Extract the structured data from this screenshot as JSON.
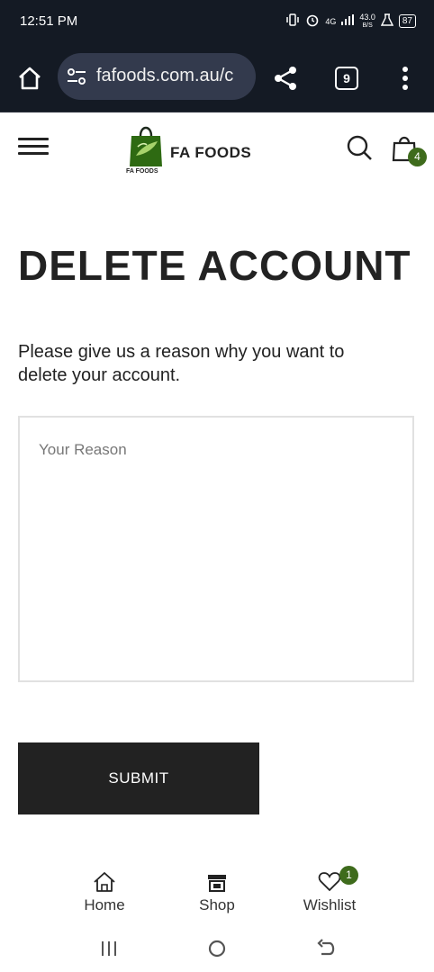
{
  "status_bar": {
    "time": "12:51 PM",
    "network": "4G",
    "speed": "43.0",
    "speed_unit": "B/S",
    "battery": "87"
  },
  "browser": {
    "url": "fafoods.com.au/c",
    "tab_count": "9"
  },
  "header": {
    "brand": "FA FOODS",
    "logo_text": "FA FOODS",
    "cart_count": "4"
  },
  "main": {
    "title": "DELETE ACCOUNT",
    "prompt": "Please give us a reason why you want to delete your account.",
    "reason_placeholder": "Your Reason",
    "submit_label": "SUBMIT"
  },
  "bottom_nav": {
    "items": [
      {
        "label": "Home",
        "icon": "home-icon"
      },
      {
        "label": "Shop",
        "icon": "shop-icon"
      },
      {
        "label": "Wishlist",
        "icon": "heart-icon"
      }
    ],
    "wishlist_count": "1"
  },
  "colors": {
    "status_bg": "#141a24",
    "accent_green": "#3e6b1c",
    "button_bg": "#222222"
  }
}
